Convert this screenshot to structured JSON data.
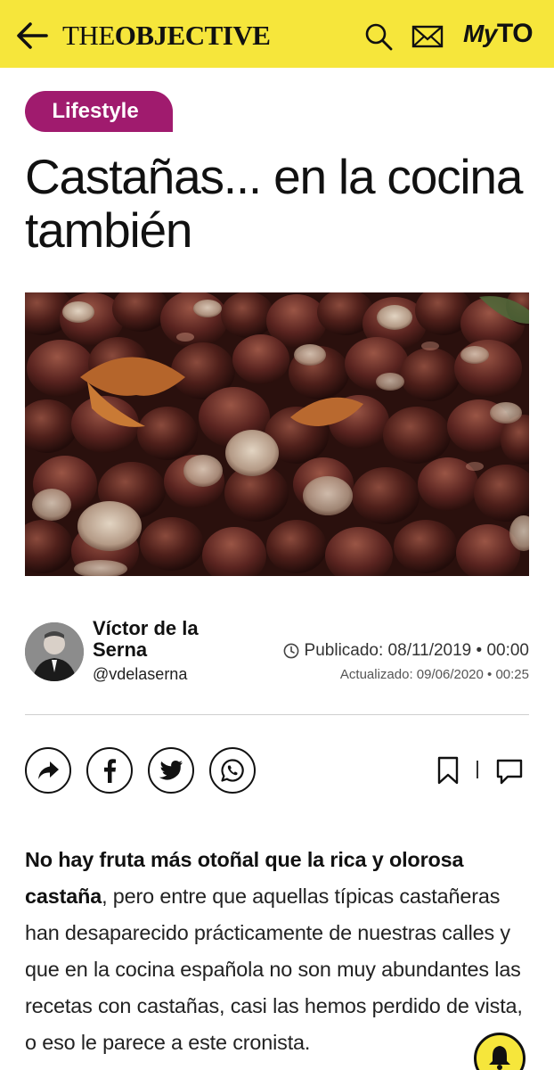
{
  "header": {
    "logo_prefix": "THE",
    "logo_main": "OBJECTIVE",
    "myto_my": "My",
    "myto_to": "TO"
  },
  "icons": [
    "back-arrow-icon",
    "search-icon",
    "mail-icon",
    "share-icon",
    "facebook-icon",
    "twitter-icon",
    "whatsapp-icon",
    "bookmark-icon",
    "comment-icon",
    "bell-icon",
    "clock-icon"
  ],
  "article": {
    "category": "Lifestyle",
    "title": "Castañas... en la cocina también",
    "author_name": "Víctor de la Serna",
    "author_handle": "@vdelaserna",
    "published": "Publicado: 08/11/2019 • 00:00",
    "updated": "Actualizado: 09/06/2020 • 00:25",
    "lead_bold": "No hay fruta más otoñal que la rica y olorosa castaña",
    "lead_rest": ", pero entre que aquellas típicas castañeras han desaparecido prácticamente de nuestras calles y que en la cocina española no son muy abundantes las recetas con castañas, casi las hemos perdido de vista, o eso le parece a este cronista."
  },
  "colors": {
    "brand_yellow": "#f6e63b",
    "tag_magenta": "#a01b6e",
    "text": "#111111"
  }
}
